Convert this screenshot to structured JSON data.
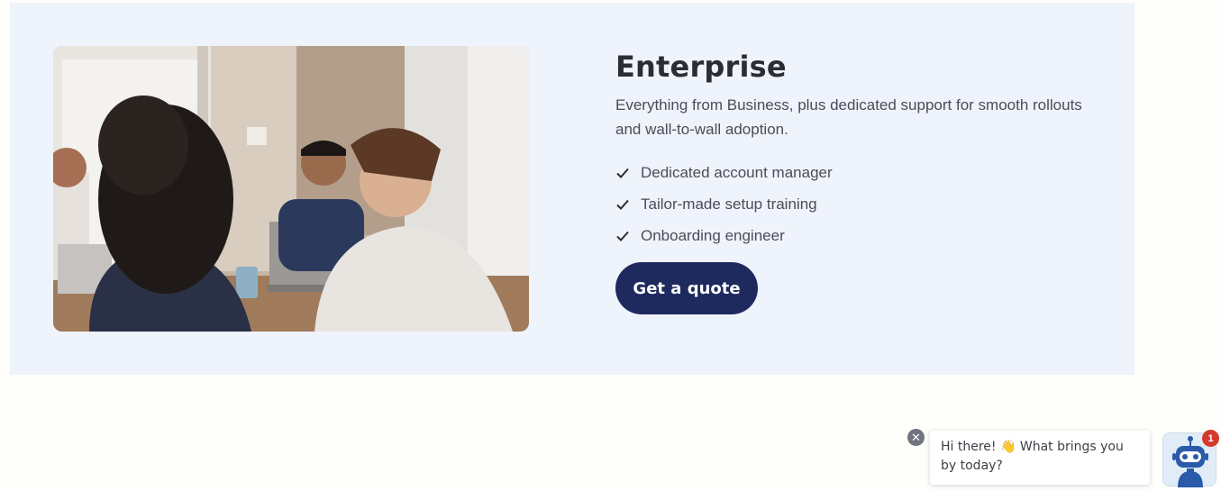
{
  "enterprise": {
    "title": "Enterprise",
    "description": "Everything from Business, plus dedicated support for smooth rollouts and wall-to-wall adoption.",
    "features": [
      {
        "label": "Dedicated account manager",
        "icon": "checkmark-icon"
      },
      {
        "label": "Tailor-made setup training",
        "icon": "checkmark-icon"
      },
      {
        "label": "Onboarding engineer",
        "icon": "checkmark-icon"
      }
    ],
    "cta_label": "Get a quote",
    "photo_icon": "team-meeting-photo"
  },
  "chat": {
    "close_icon": "close-icon",
    "close_symbol": "✕",
    "message": "Hi there! 👋 What brings you by today?",
    "bot_icon": "robot-icon",
    "badge_count": "1"
  },
  "colors": {
    "card_background": "#eff3fb",
    "cta_background": "#1e2a5e",
    "title": "#2b2d35",
    "badge": "#d43a2b"
  }
}
